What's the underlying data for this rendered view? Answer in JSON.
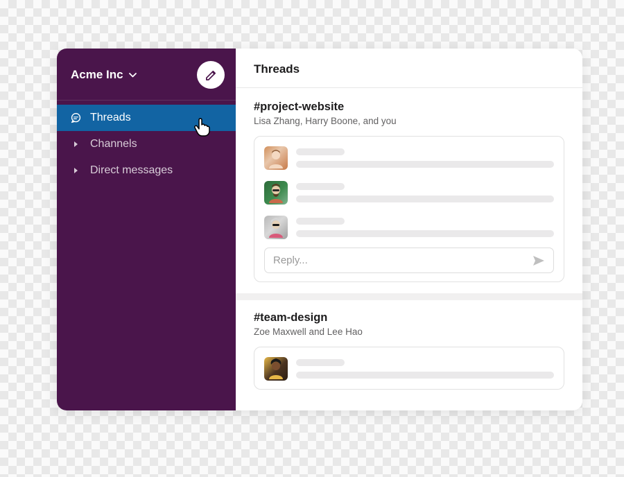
{
  "workspace": {
    "name": "Acme Inc"
  },
  "sidebar": {
    "items": [
      {
        "label": "Threads",
        "active": true
      },
      {
        "label": "Channels",
        "active": false
      },
      {
        "label": "Direct messages",
        "active": false
      }
    ]
  },
  "main": {
    "title": "Threads",
    "reply_placeholder": "Reply...",
    "threads": [
      {
        "channel": "#project-website",
        "participants": "Lisa Zhang, Harry Boone, and you",
        "messages": 3,
        "reply": true
      },
      {
        "channel": "#team-design",
        "participants": "Zoe Maxwell and Lee Hao",
        "messages": 1,
        "reply": false
      }
    ]
  },
  "colors": {
    "sidebar_bg": "#4a154b",
    "active_item_bg": "#1264a3"
  }
}
